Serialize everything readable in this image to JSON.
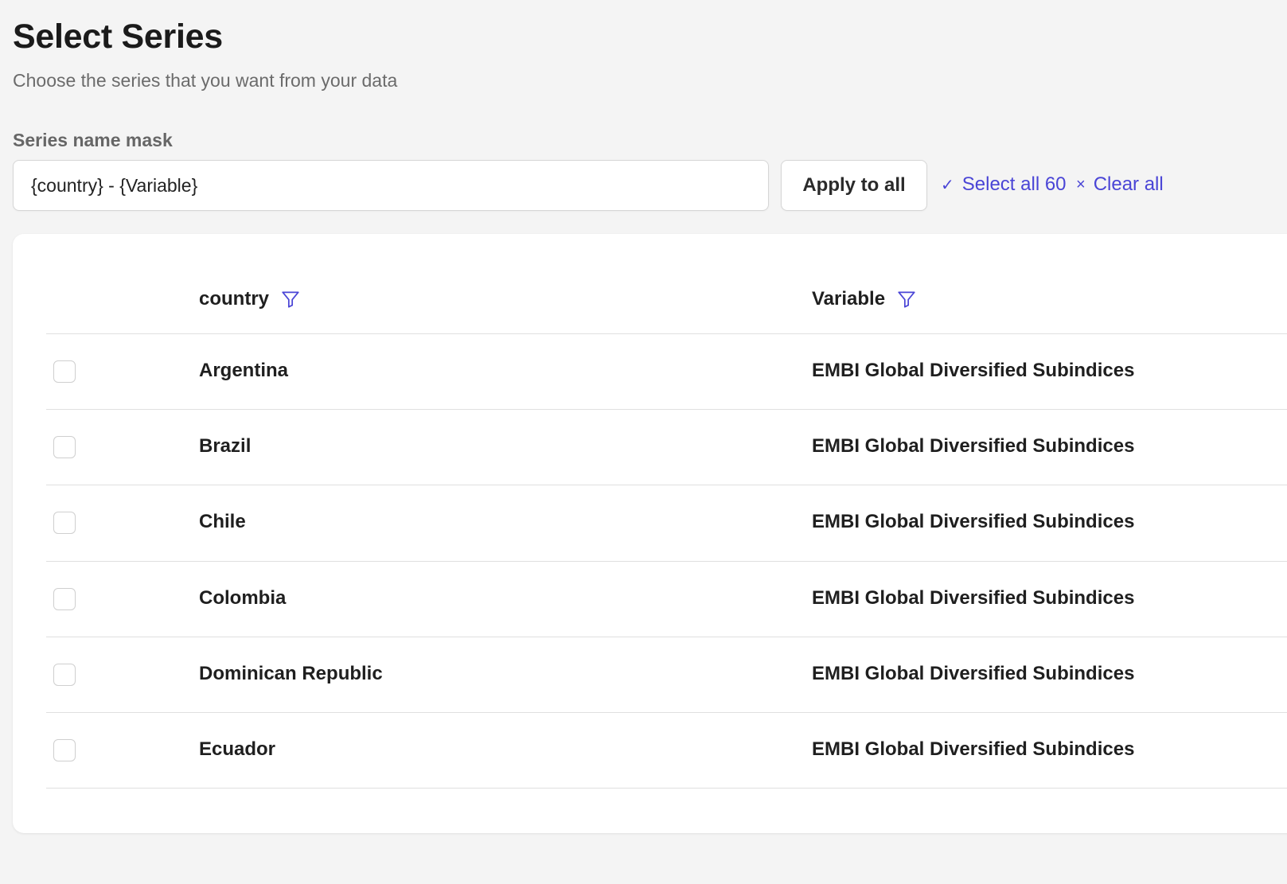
{
  "header": {
    "title": "Select Series",
    "subtitle": "Choose the series that you want from your data"
  },
  "mask": {
    "label": "Series name mask",
    "value": "{country} - {Variable}",
    "apply_label": "Apply to all"
  },
  "actions": {
    "select_all_glyph": "✓",
    "select_all_label": "Select all 60",
    "clear_all_glyph": "×",
    "clear_all_label": "Clear all"
  },
  "table": {
    "columns": [
      {
        "label": "country",
        "icon": "filter-icon"
      },
      {
        "label": "Variable",
        "icon": "filter-icon"
      }
    ],
    "rows": [
      {
        "checked": false,
        "country": "Argentina",
        "variable": "EMBI Global Diversified Subindices"
      },
      {
        "checked": false,
        "country": "Brazil",
        "variable": "EMBI Global Diversified Subindices"
      },
      {
        "checked": false,
        "country": "Chile",
        "variable": "EMBI Global Diversified Subindices"
      },
      {
        "checked": false,
        "country": "Colombia",
        "variable": "EMBI Global Diversified Subindices"
      },
      {
        "checked": false,
        "country": "Dominican Republic",
        "variable": "EMBI Global Diversified Subindices"
      },
      {
        "checked": false,
        "country": "Ecuador",
        "variable": "EMBI Global Diversified Subindices"
      }
    ]
  },
  "colors": {
    "accent": "#4a45d6",
    "background": "#f4f4f4",
    "card": "#ffffff"
  }
}
